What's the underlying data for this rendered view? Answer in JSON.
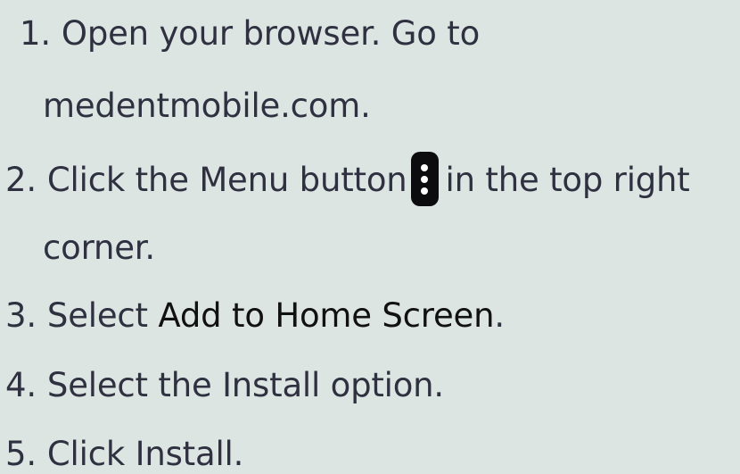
{
  "steps": [
    {
      "num": "1.",
      "text": "Open your browser. Go to"
    },
    {
      "text": "medentmobile.com."
    },
    {
      "num": "2.",
      "before": "Click the Menu button",
      "after": "in the top right",
      "icon": "kebab-menu-icon"
    },
    {
      "text": "corner."
    },
    {
      "num": "3.",
      "before": "Select",
      "strong": "Add to Home Screen",
      "after": "."
    },
    {
      "num": "4.",
      "text": "Select the Install option."
    },
    {
      "num": "5.",
      "text": "Click Install."
    }
  ],
  "colors": {
    "background": "#dde5e3",
    "text": "#2f3140",
    "icon_background": "#0c0c0f",
    "icon_dots": "#ffffff"
  }
}
